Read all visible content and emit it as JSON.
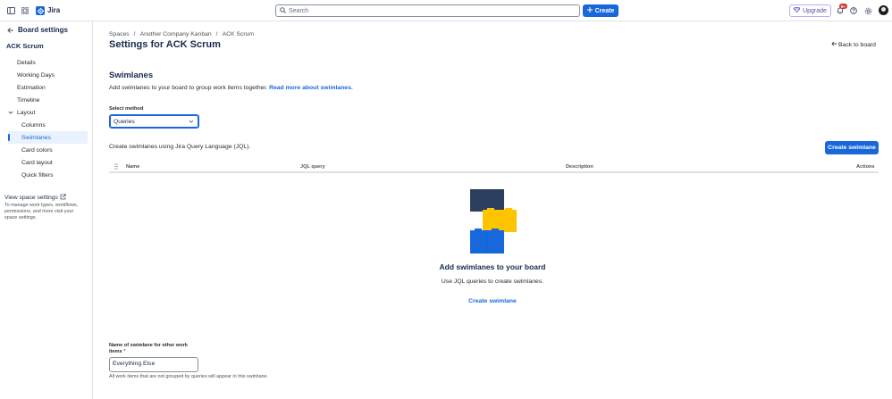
{
  "topnav": {
    "app_name": "Jira",
    "search_placeholder": "Search",
    "create_label": "Create",
    "upgrade_label": "Upgrade",
    "notification_count": "9+"
  },
  "sidebar": {
    "header_title": "Board settings",
    "board_name": "ACK Scrum",
    "items": [
      {
        "label": "Details"
      },
      {
        "label": "Working Days"
      },
      {
        "label": "Estimation"
      },
      {
        "label": "Timeline"
      },
      {
        "label": "Layout"
      },
      {
        "label": "Columns"
      },
      {
        "label": "Swimlanes"
      },
      {
        "label": "Card colors"
      },
      {
        "label": "Card layout"
      },
      {
        "label": "Quick filters"
      }
    ],
    "view_space_settings": "View space settings",
    "view_space_desc": "To manage work types, workflows, permissions, and more visit your space settings."
  },
  "main": {
    "breadcrumbs": [
      "Spaces",
      "/",
      "Another Company Kanban",
      "/",
      "ACK Scrum"
    ],
    "title": "Settings for ACK Scrum",
    "back_to_board": "Back to board",
    "section_title": "Swimlanes",
    "section_desc": "Add swimlanes to your board to group work items together.",
    "section_link": "Read more about swimlanes.",
    "select_label": "Select method",
    "select_value": "Queries",
    "jql_desc": "Create swimlanes using Jira Query Language (JQL).",
    "create_swimlane_button": "Create swimlane",
    "table_headers": {
      "name": "Name",
      "jql": "JQL query",
      "description": "Description",
      "actions": "Actions"
    },
    "empty_title": "Add swimlanes to your board",
    "empty_desc": "Use JQL queries to create swimlanes.",
    "empty_link": "Create swimlane",
    "other_label": "Name of swimlane for other work items",
    "other_required": "*",
    "other_value": "Everything Else",
    "other_helper": "All work items that are not grouped by queries will appear in this swimlane."
  },
  "colors": {
    "brand_blue": "#1868db",
    "active_bg": "#e9f2fe",
    "upgrade_purple": "#5e4db2",
    "badge_red": "#c9372c"
  }
}
